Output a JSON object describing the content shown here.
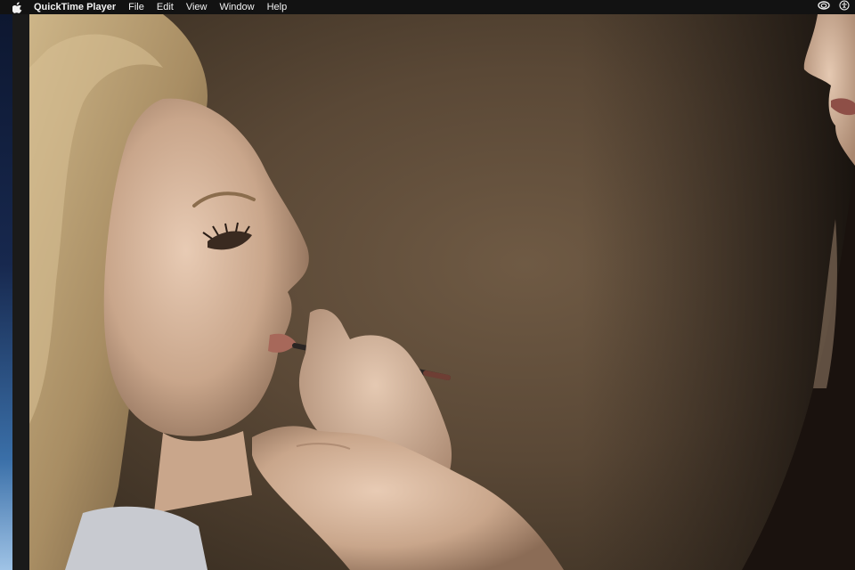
{
  "menubar": {
    "app_name": "QuickTime Player",
    "items": [
      "File",
      "Edit",
      "View",
      "Window",
      "Help"
    ],
    "icons": {
      "left": "apple-icon",
      "right": [
        "creative-cloud-icon",
        "accessibility-icon"
      ]
    }
  },
  "video": {
    "content": "video-frame"
  },
  "colors": {
    "menubar_bg": "#121212",
    "menubar_text": "#f2f2f2",
    "backdrop": "#5a4836"
  }
}
